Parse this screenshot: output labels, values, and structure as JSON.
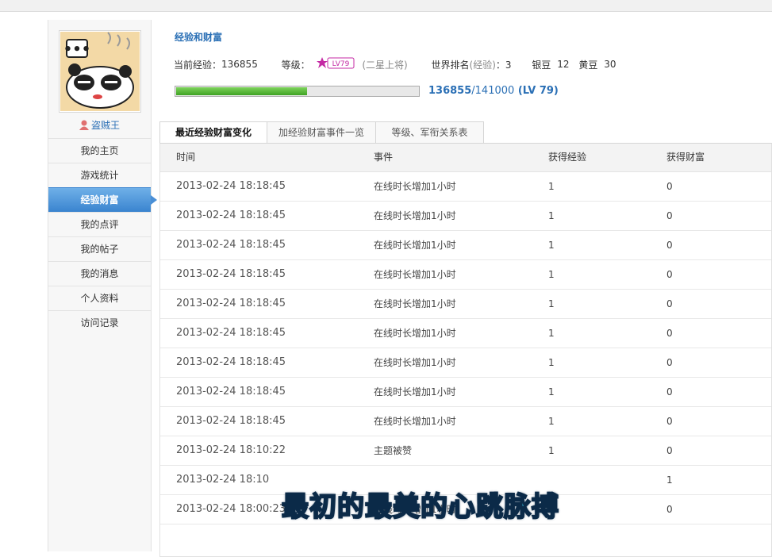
{
  "user": {
    "name": "盗贼王"
  },
  "sidebar": {
    "items": [
      {
        "label": "我的主页"
      },
      {
        "label": "游戏统计"
      },
      {
        "label": "经验财富",
        "active": true
      },
      {
        "label": "我的点评"
      },
      {
        "label": "我的帖子"
      },
      {
        "label": "我的消息"
      },
      {
        "label": "个人资料"
      },
      {
        "label": "访问记录"
      }
    ]
  },
  "main": {
    "title": "经验和财富",
    "exp_label": "当前经验：",
    "exp_value": "136855",
    "level_label": "等级：",
    "level_badge": "LV79",
    "level_rank": "(二星上将)",
    "rank_label": "世界排名",
    "rank_sub": "(经验)",
    "rank_value": "：3",
    "silver_label": "银豆",
    "silver_value": "12",
    "gold_label": "黄豆",
    "gold_value": "30",
    "progress_fraction": 0.5408,
    "progress_cur": "136855",
    "progress_rest": "/141000",
    "progress_lv": " (LV 79)"
  },
  "tabs": [
    {
      "label": "最近经验财富变化",
      "active": true
    },
    {
      "label": "加经验财富事件一览"
    },
    {
      "label": "等级、军衔关系表"
    }
  ],
  "table": {
    "headers": [
      "时间",
      "事件",
      "获得经验",
      "获得财富"
    ],
    "rows": [
      [
        "2013-02-24 18:18:45",
        "在线时长增加1小时",
        "1",
        "0"
      ],
      [
        "2013-02-24 18:18:45",
        "在线时长增加1小时",
        "1",
        "0"
      ],
      [
        "2013-02-24 18:18:45",
        "在线时长增加1小时",
        "1",
        "0"
      ],
      [
        "2013-02-24 18:18:45",
        "在线时长增加1小时",
        "1",
        "0"
      ],
      [
        "2013-02-24 18:18:45",
        "在线时长增加1小时",
        "1",
        "0"
      ],
      [
        "2013-02-24 18:18:45",
        "在线时长增加1小时",
        "1",
        "0"
      ],
      [
        "2013-02-24 18:18:45",
        "在线时长增加1小时",
        "1",
        "0"
      ],
      [
        "2013-02-24 18:18:45",
        "在线时长增加1小时",
        "1",
        "0"
      ],
      [
        "2013-02-24 18:18:45",
        "在线时长增加1小时",
        "1",
        "0"
      ],
      [
        "2013-02-24 18:10:22",
        "主题被赞",
        "1",
        "0"
      ],
      [
        "2013-02-24 18:10",
        "",
        "",
        "1"
      ],
      [
        "2013-02-24 18:00:23",
        "在线时长增加1小时",
        "1",
        "0"
      ]
    ]
  },
  "overlay": {
    "subtitle": "最初的最美的心跳脉搏"
  },
  "colors": {
    "accent": "#2a6fb5",
    "active_menu": "#4a8fd6",
    "progress": "#4fb02c"
  }
}
